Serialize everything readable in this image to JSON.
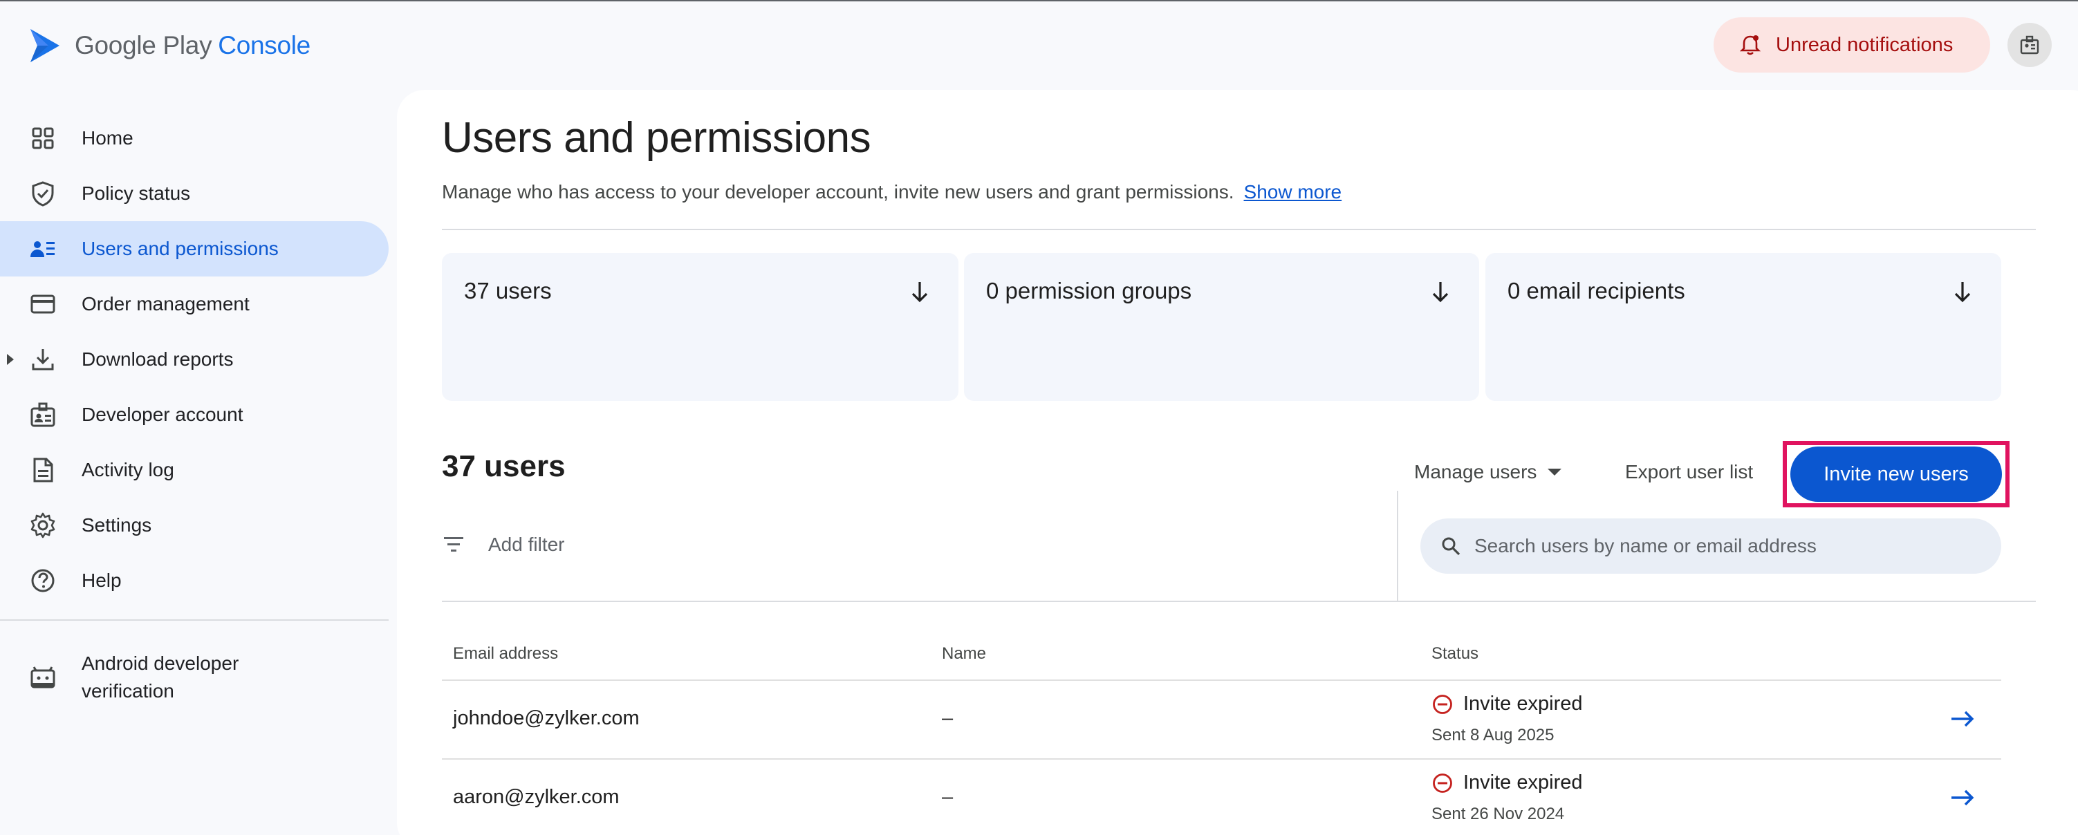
{
  "header": {
    "app_name_part1": "Google Play",
    "app_name_part2": "Console",
    "notifications_label": "Unread notifications"
  },
  "sidebar": {
    "items": [
      {
        "label": "Home",
        "icon": "grid-icon"
      },
      {
        "label": "Policy status",
        "icon": "shield-check-icon"
      },
      {
        "label": "Users and permissions",
        "icon": "users-list-icon",
        "active": true
      },
      {
        "label": "Order management",
        "icon": "credit-card-icon"
      },
      {
        "label": "Download reports",
        "icon": "download-icon"
      },
      {
        "label": "Developer account",
        "icon": "id-badge-icon"
      },
      {
        "label": "Activity log",
        "icon": "document-icon"
      },
      {
        "label": "Settings",
        "icon": "gear-icon"
      },
      {
        "label": "Help",
        "icon": "help-icon"
      }
    ],
    "verification_line1": "Android developer",
    "verification_line2": "verification"
  },
  "main": {
    "title": "Users and permissions",
    "description": "Manage who has access to your developer account, invite new users and grant permissions.",
    "show_more": "Show more",
    "stats": [
      {
        "label": "37 users"
      },
      {
        "label": "0 permission groups"
      },
      {
        "label": "0 email recipients"
      }
    ],
    "section_title": "37 users",
    "manage_users": "Manage users",
    "export_user_list": "Export user list",
    "invite_new_users": "Invite new users",
    "add_filter": "Add filter",
    "search_placeholder": "Search users by name or email address",
    "table": {
      "headers": {
        "email": "Email address",
        "name": "Name",
        "status": "Status"
      },
      "rows": [
        {
          "email": "johndoe@zylker.com",
          "name": "–",
          "status": "Invite expired",
          "sent": "Sent 8 Aug 2025"
        },
        {
          "email": "aaron@zylker.com",
          "name": "–",
          "status": "Invite expired",
          "sent": "Sent 26 Nov 2024"
        }
      ]
    }
  },
  "colors": {
    "accent": "#0b57d0",
    "active_nav_bg": "#d3e3fd",
    "notification_bg": "#fce4e2",
    "notification_text": "#a50e0e",
    "highlight_border": "#e0135f",
    "status_expired": "#c5221f"
  }
}
